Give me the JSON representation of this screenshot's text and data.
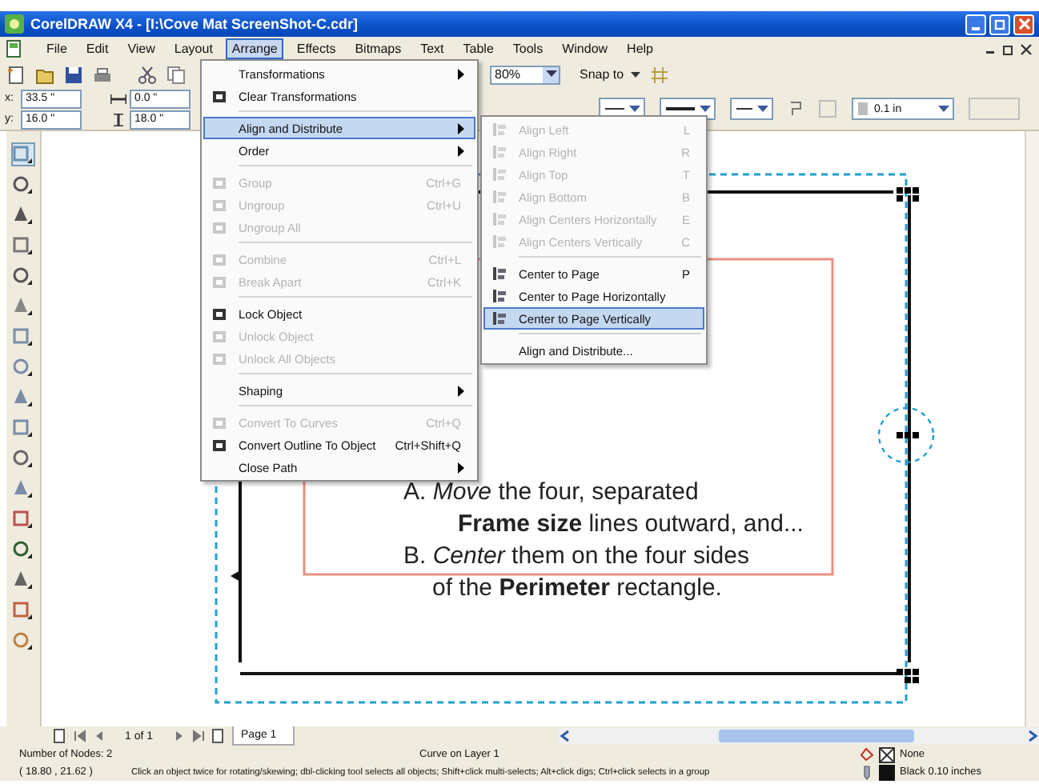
{
  "window": {
    "title": "CorelDRAW X4 - [I:\\Cove Mat ScreenShot-C.cdr]"
  },
  "menu_bar": [
    {
      "label": "File",
      "selected": false
    },
    {
      "label": "Edit",
      "selected": false
    },
    {
      "label": "View",
      "selected": false
    },
    {
      "label": "Layout",
      "selected": false
    },
    {
      "label": "Arrange",
      "selected": true
    },
    {
      "label": "Effects",
      "selected": false
    },
    {
      "label": "Bitmaps",
      "selected": false
    },
    {
      "label": "Text",
      "selected": false
    },
    {
      "label": "Table",
      "selected": false
    },
    {
      "label": "Tools",
      "selected": false
    },
    {
      "label": "Window",
      "selected": false
    },
    {
      "label": "Help",
      "selected": false
    }
  ],
  "toolbar": {
    "zoom": "80%",
    "snap_to": "Snap to"
  },
  "property_bar": {
    "position": [
      {
        "label": "x:",
        "value": "33.5 \""
      },
      {
        "label": "y:",
        "value": "16.0 \""
      }
    ],
    "size": [
      "0.0 \"",
      "18.0 \""
    ],
    "outline_width": "0.1 in"
  },
  "arrange_menu": [
    {
      "kind": "item",
      "label": "Transformations",
      "submenu": true,
      "disabled": false,
      "selected": false
    },
    {
      "kind": "item",
      "label": "Clear Transformations",
      "submenu": false,
      "disabled": false,
      "selected": false
    },
    {
      "kind": "separator"
    },
    {
      "kind": "item",
      "label": "Align and Distribute",
      "submenu": true,
      "disabled": false,
      "selected": true
    },
    {
      "kind": "item",
      "label": "Order",
      "submenu": true,
      "disabled": false,
      "selected": false
    },
    {
      "kind": "separator"
    },
    {
      "kind": "item",
      "label": "Group",
      "shortcut": "Ctrl+G",
      "submenu": false,
      "disabled": true,
      "selected": false
    },
    {
      "kind": "item",
      "label": "Ungroup",
      "shortcut": "Ctrl+U",
      "submenu": false,
      "disabled": true,
      "selected": false
    },
    {
      "kind": "item",
      "label": "Ungroup All",
      "submenu": false,
      "disabled": true,
      "selected": false
    },
    {
      "kind": "separator"
    },
    {
      "kind": "item",
      "label": "Combine",
      "shortcut": "Ctrl+L",
      "submenu": false,
      "disabled": true,
      "selected": false
    },
    {
      "kind": "item",
      "label": "Break Apart",
      "shortcut": "Ctrl+K",
      "submenu": false,
      "disabled": true,
      "selected": false
    },
    {
      "kind": "separator"
    },
    {
      "kind": "item",
      "label": "Lock Object",
      "submenu": false,
      "disabled": false,
      "selected": false
    },
    {
      "kind": "item",
      "label": "Unlock Object",
      "submenu": false,
      "disabled": true,
      "selected": false
    },
    {
      "kind": "item",
      "label": "Unlock All Objects",
      "submenu": false,
      "disabled": true,
      "selected": false
    },
    {
      "kind": "separator"
    },
    {
      "kind": "item",
      "label": "Shaping",
      "submenu": true,
      "disabled": false,
      "selected": false
    },
    {
      "kind": "separator"
    },
    {
      "kind": "item",
      "label": "Convert To Curves",
      "shortcut": "Ctrl+Q",
      "submenu": false,
      "disabled": true,
      "selected": false
    },
    {
      "kind": "item",
      "label": "Convert Outline To Object",
      "shortcut": "Ctrl+Shift+Q",
      "submenu": false,
      "disabled": false,
      "selected": false
    },
    {
      "kind": "item",
      "label": "Close Path",
      "submenu": true,
      "disabled": false,
      "selected": false
    }
  ],
  "align_submenu": [
    {
      "kind": "item",
      "label": "Align Left",
      "shortcut": "L",
      "disabled": true,
      "selected": false
    },
    {
      "kind": "item",
      "label": "Align Right",
      "shortcut": "R",
      "disabled": true,
      "selected": false
    },
    {
      "kind": "item",
      "label": "Align Top",
      "shortcut": "T",
      "disabled": true,
      "selected": false
    },
    {
      "kind": "item",
      "label": "Align Bottom",
      "shortcut": "B",
      "disabled": true,
      "selected": false
    },
    {
      "kind": "item",
      "label": "Align Centers Horizontally",
      "shortcut": "E",
      "disabled": true,
      "selected": false
    },
    {
      "kind": "item",
      "label": "Align Centers Vertically",
      "shortcut": "C",
      "disabled": true,
      "selected": false
    },
    {
      "kind": "separator"
    },
    {
      "kind": "item",
      "label": "Center to Page",
      "shortcut": "P",
      "disabled": false,
      "selected": false
    },
    {
      "kind": "item",
      "label": "Center to Page Horizontally",
      "disabled": false,
      "selected": false
    },
    {
      "kind": "item",
      "label": "Center to Page Vertically",
      "disabled": false,
      "selected": true
    },
    {
      "kind": "separator"
    },
    {
      "kind": "item",
      "label": "Align and Distribute...",
      "disabled": false,
      "selected": false
    }
  ],
  "canvas": {
    "text_lines": [
      "A. *Move* the four, separated",
      "**Frame size** lines outward, and...",
      "B. *Center* them on the four sides",
      "of the **Perimeter** rectangle."
    ]
  },
  "page_navigator": {
    "count": "1 of 1",
    "tabs": [
      {
        "label": "Page 1",
        "selected": true
      }
    ]
  },
  "status_bar": {
    "nodes": "Number of Nodes: 2",
    "object": "Curve on Layer 1",
    "coordinates": "( 18.80 , 21.62 )",
    "hint": "Click an object twice for rotating/skewing; dbl-clicking tool selects all objects; Shift+click multi-selects; Alt+click digs; Ctrl+click selects in a group",
    "fill": "None",
    "outline": "Black  0.10 inches"
  }
}
